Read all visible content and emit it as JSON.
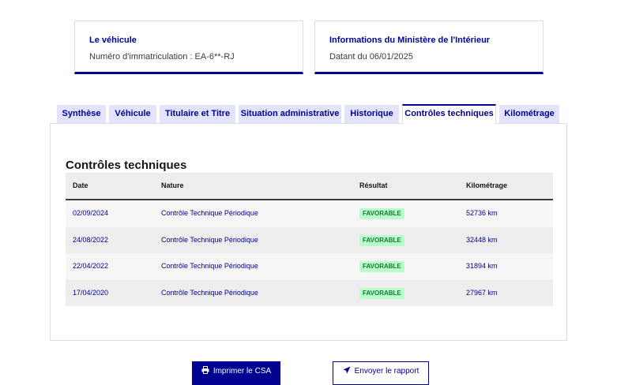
{
  "cards": {
    "vehicle": {
      "title": "Le véhicule",
      "text": "Numéro d'immatriculation : EA-6**-RJ"
    },
    "ministry": {
      "title": "Informations du Ministère de l'Intérieur",
      "text": "Datant du 06/01/2025"
    }
  },
  "tabs": [
    {
      "label": "Synthèse"
    },
    {
      "label": "Véhicule"
    },
    {
      "label": "Titulaire et Titre"
    },
    {
      "label": "Situation administrative"
    },
    {
      "label": "Historique"
    },
    {
      "label": "Contrôles techniques",
      "active": true
    },
    {
      "label": "Kilométrage"
    }
  ],
  "section": {
    "title": "Contrôles techniques",
    "columns": [
      "Date",
      "Nature",
      "Résultat",
      "Kilométrage"
    ],
    "rows": [
      {
        "date": "02/09/2024",
        "nature": "Contrôle Technique Périodique",
        "result": "FAVORABLE",
        "km": "52736 km"
      },
      {
        "date": "24/08/2022",
        "nature": "Contrôle Technique Périodique",
        "result": "FAVORABLE",
        "km": "32448 km"
      },
      {
        "date": "22/04/2022",
        "nature": "Contrôle Technique Périodique",
        "result": "FAVORABLE",
        "km": "31894 km"
      },
      {
        "date": "17/04/2020",
        "nature": "Contrôle Technique Périodique",
        "result": "FAVORABLE",
        "km": "27967 km"
      }
    ]
  },
  "actions": {
    "print_label": "Imprimer le CSA",
    "print_icon": "printer-icon",
    "send_label": "Envoyer le rapport",
    "send_icon": "send-icon"
  },
  "colors": {
    "primary": "#000091",
    "success_bg": "#b8fec9",
    "success_text": "#18753c",
    "tab_bg": "#e3e3fd"
  }
}
